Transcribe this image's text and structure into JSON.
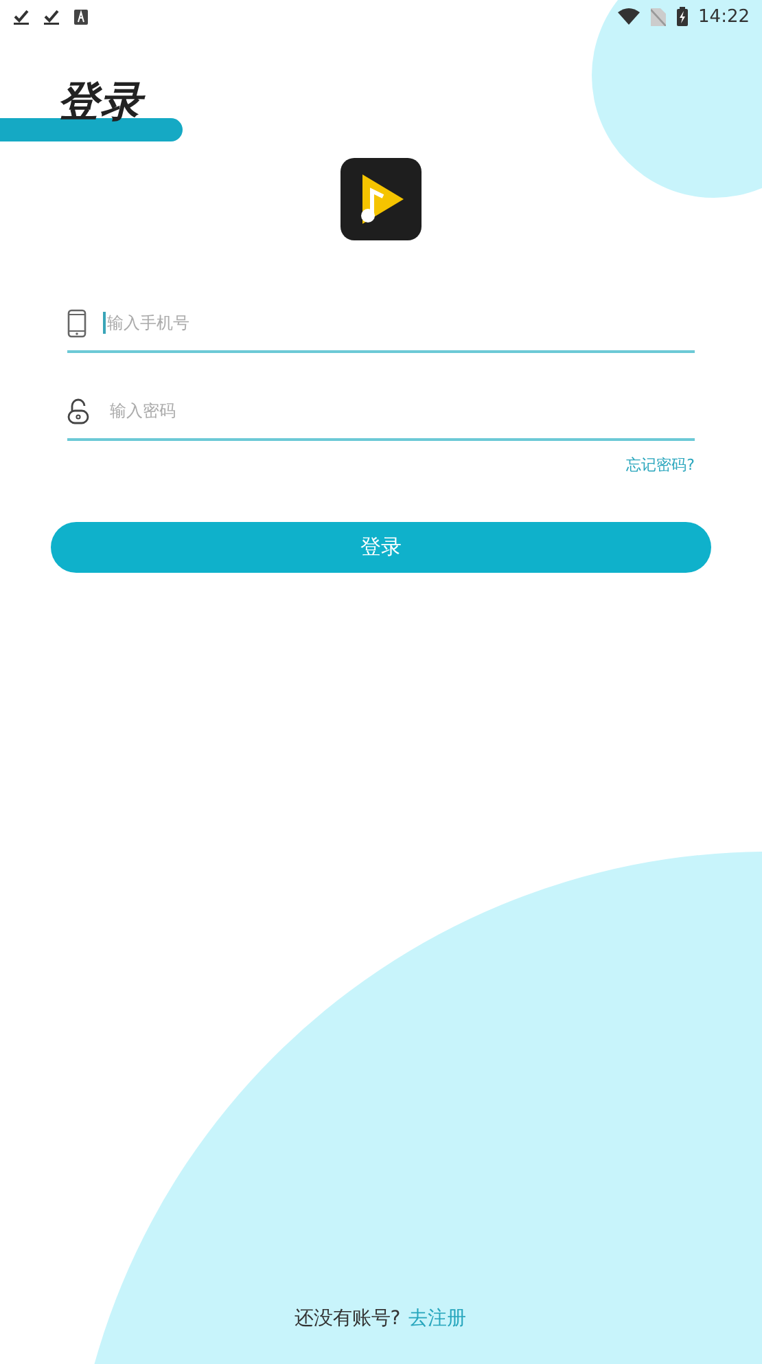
{
  "status_bar": {
    "time": "14:22"
  },
  "title": "登录",
  "phone_field": {
    "placeholder": "输入手机号",
    "focused": true
  },
  "password_field": {
    "placeholder": "输入密码",
    "focused": false
  },
  "forgot_link": "忘记密码?",
  "login_button": "登录",
  "signup": {
    "prompt": "还没有账号?",
    "link": "去注册"
  }
}
